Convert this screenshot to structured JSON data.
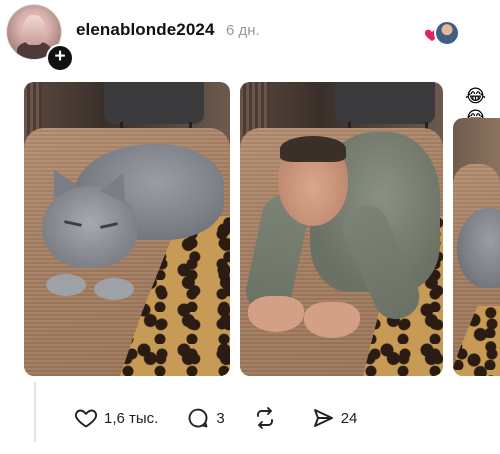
{
  "post": {
    "author": "elenablonde2024",
    "time": "6 дн.",
    "follow_symbol": "+"
  },
  "carousel": {
    "next_preview_emoji": "😂😂"
  },
  "actions": {
    "likes": "1,6 тыс.",
    "replies": "3",
    "reposts": "",
    "shares": "24"
  },
  "icons": {
    "like": "heart-outline-icon",
    "reply": "speech-bubble-icon",
    "repost": "repost-arrows-icon",
    "share": "send-arrow-icon",
    "liked_indicator": "red-heart-icon"
  },
  "colors": {
    "liked_heart": "#e0245e",
    "text_primary": "#111111",
    "text_secondary": "#999999"
  }
}
